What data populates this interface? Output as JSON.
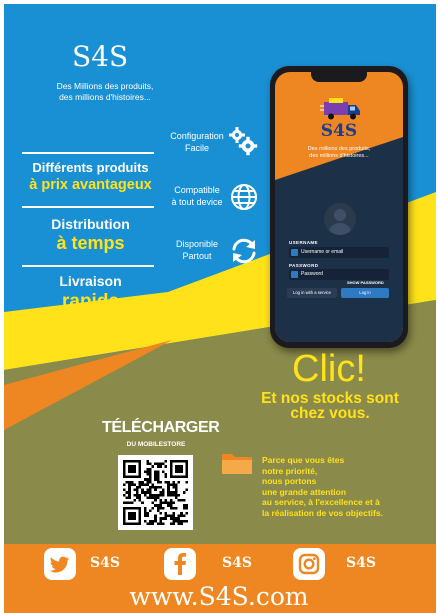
{
  "header": {
    "brand": "S4S",
    "tagline_line1": "Des Millions des produits,",
    "tagline_line2": "des millions d'histoires..."
  },
  "features": [
    {
      "white": "Différents produits",
      "yellow": "à prix avantageux"
    },
    {
      "white": "Distribution",
      "yellow": "à temps"
    },
    {
      "white": "Livraison",
      "yellow": "rapide"
    }
  ],
  "services": [
    {
      "line1": "Configuration",
      "line2": "Facile",
      "icon": "gears-icon"
    },
    {
      "line1": "Compatible",
      "line2": "à tout device",
      "icon": "globe-icon"
    },
    {
      "line1": "Disponible",
      "line2": "Partout",
      "icon": "sync-icon"
    }
  ],
  "phone_app": {
    "brand": "S4S",
    "tagline_line1": "Des millions des produits,",
    "tagline_line2": "des millions d'histoires...",
    "username_label": "USERNAME",
    "username_placeholder": "Username or email",
    "password_label": "PASSWORD",
    "password_placeholder": "Password",
    "show_password": "SHOW PASSWORD",
    "secondary_button": "Log in with a service",
    "login_button": "Log in"
  },
  "clic": {
    "title": "Clic!",
    "subtitle_line1": "Et nos stocks sont",
    "subtitle_line2": "chez vous."
  },
  "download": {
    "title": "TÉLÉCHARGER",
    "subtitle": "DU MOBILESTORE"
  },
  "promise_lines": [
    "Parce que vous êtes",
    "notre priorité,",
    "nous portons",
    "une grande attention",
    "au service, à l'excellence et à",
    "la réalisation de vos objectifs."
  ],
  "footer": {
    "social": [
      {
        "icon": "twitter-icon",
        "label": "S4S"
      },
      {
        "icon": "facebook-icon",
        "label": "S4S"
      },
      {
        "icon": "instagram-icon",
        "label": "S4S"
      }
    ],
    "website": "www.S4S.com"
  },
  "colors": {
    "blue": "#1a90d4",
    "yellow": "#ffe21a",
    "orange": "#ee8722",
    "olive": "#8a8a4a",
    "navy": "#1d3b8f"
  }
}
